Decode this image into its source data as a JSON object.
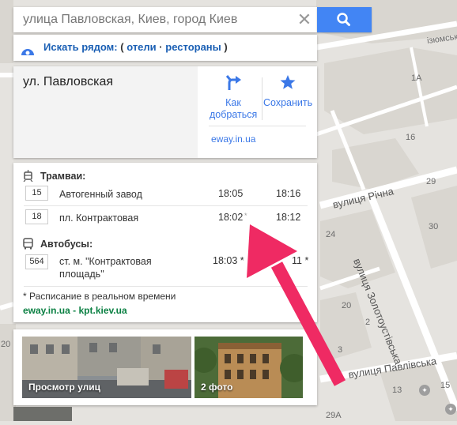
{
  "colors": {
    "map_bg": "#e5e3df",
    "block": "#d9d6d0",
    "road": "#ffffff",
    "link_blue": "#3b78e7",
    "search_blue": "#4285f4",
    "green_link": "#0b8043",
    "arrow": "#ef2a63"
  },
  "map": {
    "labels": [
      "ізюмська",
      "вулиця Річна",
      "вулиця Золотоустівська",
      "вулиця Павлівська",
      "1А",
      "16",
      "29",
      "30",
      "24",
      "20",
      "2",
      "3",
      "13",
      "15",
      "29А",
      "20"
    ]
  },
  "search": {
    "value": "улица Павловская, Киев, город Киев",
    "clear_icon": "close-icon",
    "button_icon": "search-icon"
  },
  "nearby": {
    "label": "Искать рядом:",
    "open": "(",
    "hotels": "отели",
    "dot": "·",
    "restaurants": "рестораны",
    "close": ")"
  },
  "place": {
    "name": "ул. Павловская",
    "route_line1": "Как",
    "route_line2": "добраться",
    "save": "Сохранить",
    "eway": "eway.in.ua"
  },
  "transit": {
    "trams_title": "Трамваи:",
    "buses_title": "Автобусы:",
    "trams": [
      {
        "route": "15",
        "stop": "Автогенный завод",
        "time1": "18:05",
        "time2": "18:16"
      },
      {
        "route": "18",
        "stop": "пл. Контрактовая",
        "time1": "18:02",
        "realtime_mark": "*",
        "time2": "18:12"
      }
    ],
    "buses": [
      {
        "route": "564",
        "stop_line1": "ст. м. \"Контрактовая",
        "stop_line2": "площадь\"",
        "time1": "18:03 *",
        "time2": "11 *"
      }
    ],
    "realtime_note": "* Расписание в реальном времени",
    "source_1": "eway.in.ua",
    "source_sep": " - ",
    "source_2": "kpt.kiev.ua"
  },
  "photos": {
    "street_view": "Просмотр улиц",
    "photos_count": "2 фото"
  }
}
